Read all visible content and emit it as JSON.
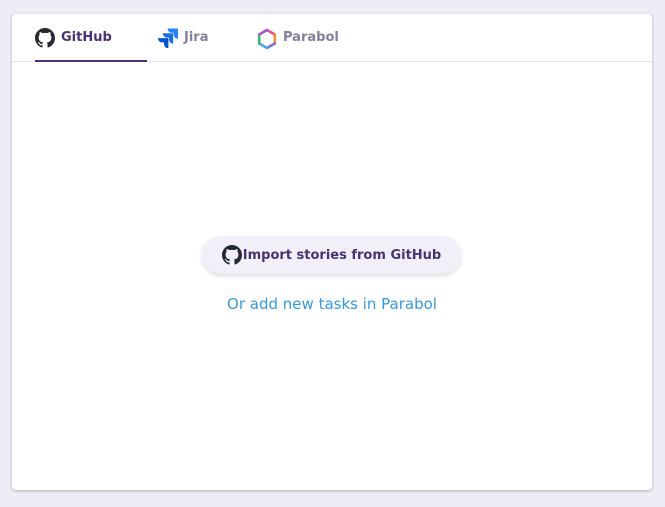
{
  "tabs": [
    {
      "label": "GitHub",
      "icon": "github-icon",
      "active": true
    },
    {
      "label": "Jira",
      "icon": "jira-icon",
      "active": false
    },
    {
      "label": "Parabol",
      "icon": "parabol-icon",
      "active": false
    }
  ],
  "main": {
    "import_button_label": "Import stories from GitHub",
    "import_button_icon": "github-icon",
    "add_tasks_link": "Or add new tasks in Parabol"
  },
  "colors": {
    "accent": "#493272",
    "inactive_text": "#82809a",
    "link": "#329ae5",
    "background": "#eeecf5"
  }
}
